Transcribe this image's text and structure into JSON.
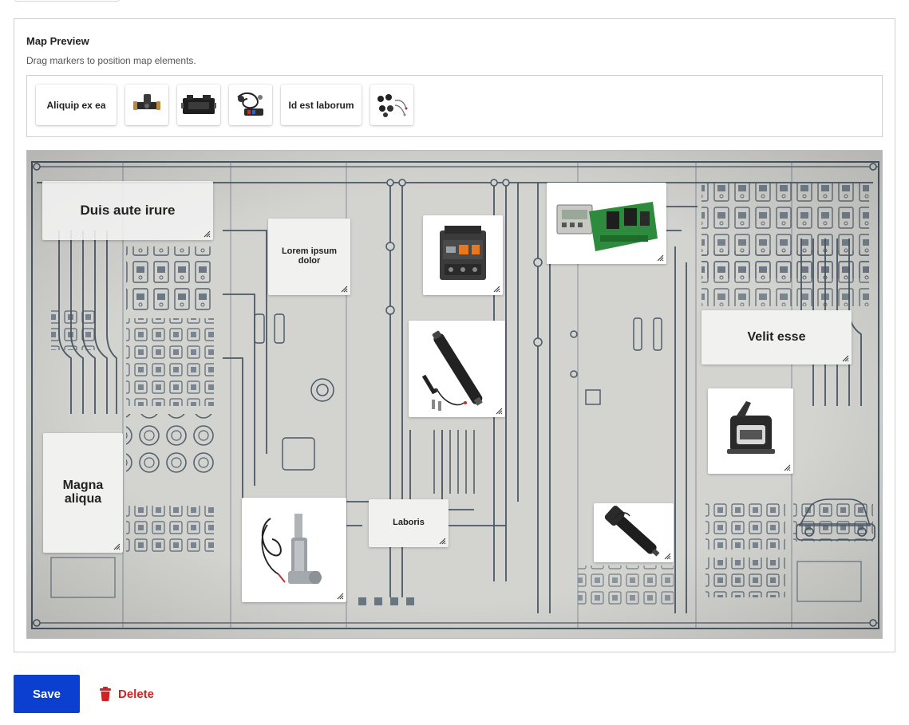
{
  "panel": {
    "title": "Map Preview",
    "help": "Drag markers to position map elements."
  },
  "palette": {
    "chips": [
      {
        "type": "text",
        "label": "Aliquip ex ea"
      },
      {
        "type": "image",
        "icon": "pipe-tee-connector-icon"
      },
      {
        "type": "image",
        "icon": "control-module-box-icon"
      },
      {
        "type": "image",
        "icon": "wiring-harness-icon"
      },
      {
        "type": "text",
        "label": "Id est laborum"
      },
      {
        "type": "image",
        "icon": "connector-set-icon"
      }
    ]
  },
  "map": {
    "background": "electrical-wiring-diagram",
    "markers": [
      {
        "label": "Duis aute irure"
      },
      {
        "label": "Lorem ipsum dolor"
      },
      {
        "image": "contactor-icon"
      },
      {
        "image": "control-board-icon"
      },
      {
        "label": "Velit esse"
      },
      {
        "image": "linear-actuator-icon"
      },
      {
        "image": "motor-mount-icon"
      },
      {
        "label": "Magna aliqua"
      },
      {
        "image": "linear-actuator-motor-icon"
      },
      {
        "label": "Laboris"
      },
      {
        "image": "actuator-arm-icon"
      }
    ]
  },
  "actions": {
    "save_label": "Save",
    "delete_label": "Delete"
  },
  "colors": {
    "save_button": "#0a3fcf",
    "delete_text": "#d32020",
    "map_background": "#cfcfcc",
    "diagram_lines": "#4a5866"
  }
}
